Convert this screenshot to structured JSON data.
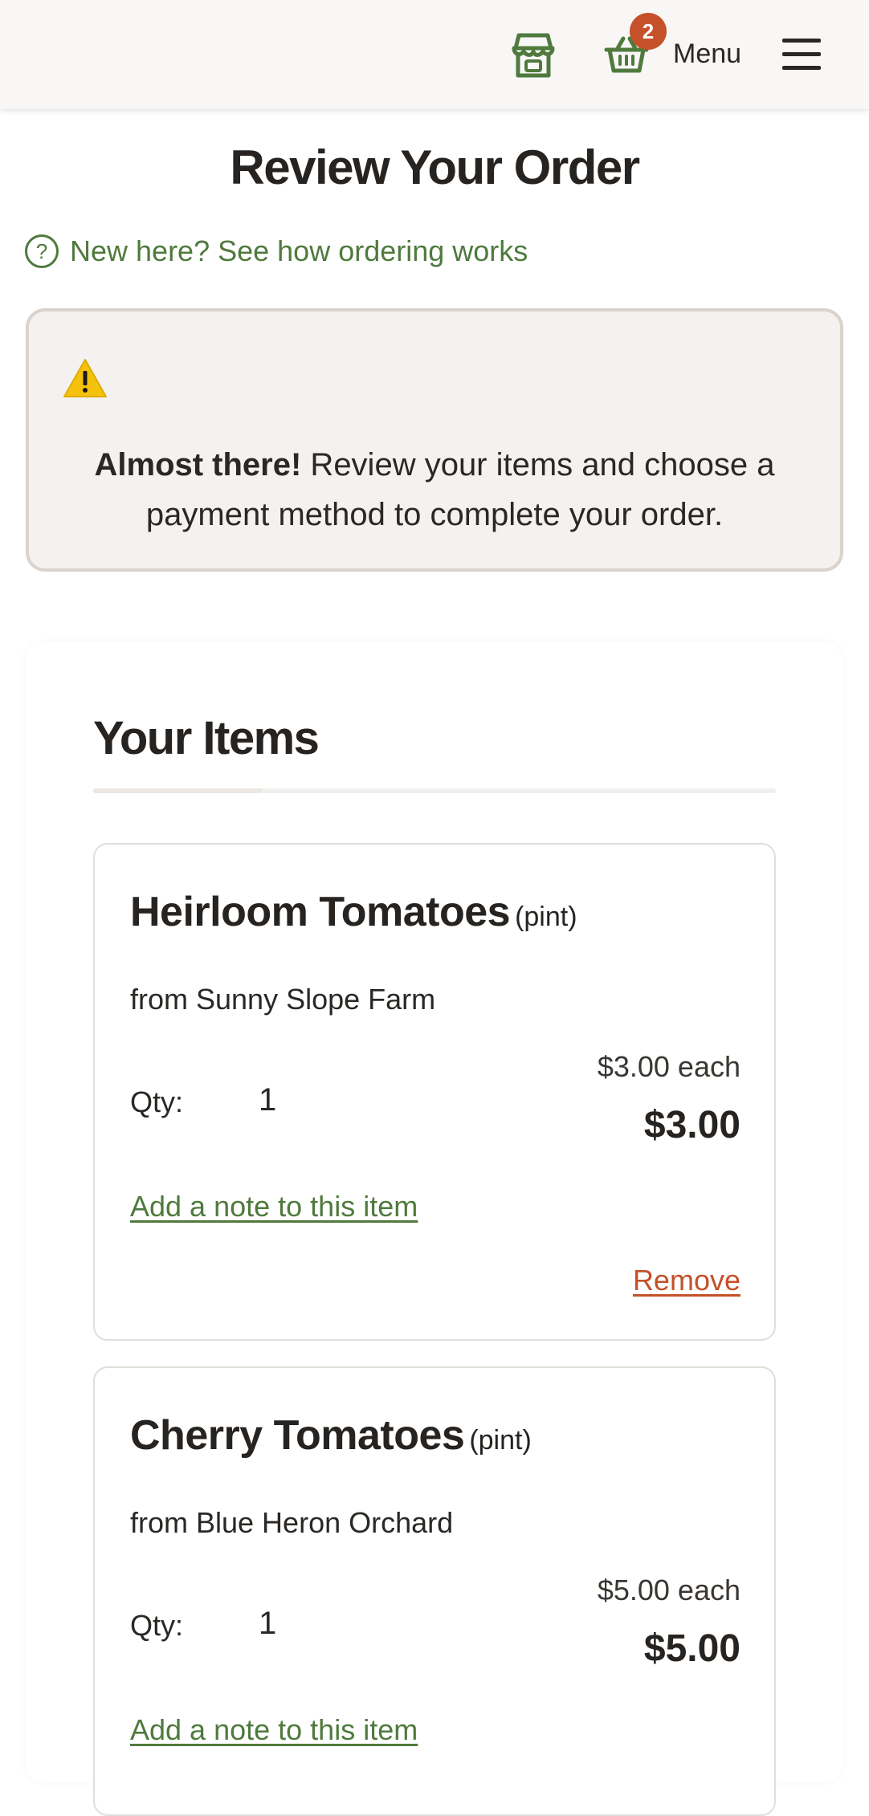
{
  "header": {
    "store_icon": "storefront-icon",
    "basket_icon": "basket-icon",
    "cart_count": "2",
    "menu_label": "Menu",
    "menu_icon": "hamburger-icon"
  },
  "page": {
    "title": "Review Your Order",
    "help_link": "New here? See how ordering works"
  },
  "notice": {
    "icon": "warning-icon",
    "bold": "Almost there!",
    "text": " Review your items and choose a payment method to complete your order."
  },
  "items_section": {
    "heading": "Your Items",
    "items": [
      {
        "name": "Heirloom Tomatoes",
        "unit": "(pint)",
        "farm": "from Sunny Slope Farm",
        "qty_label": "Qty:",
        "qty": "1",
        "unit_price": "$3.00 each",
        "total": "$3.00",
        "note_link": "Add a note to this item",
        "remove_label": "Remove"
      },
      {
        "name": "Cherry Tomatoes",
        "unit": "(pint)",
        "farm": "from Blue Heron Orchard",
        "qty_label": "Qty:",
        "qty": "1",
        "unit_price": "$5.00 each",
        "total": "$5.00",
        "note_link": "Add a note to this item"
      }
    ]
  },
  "colors": {
    "accent_green": "#4f7a3d",
    "remove_red": "#c4512a",
    "badge": "#c4512a",
    "warning_yellow": "#f4c20d"
  }
}
